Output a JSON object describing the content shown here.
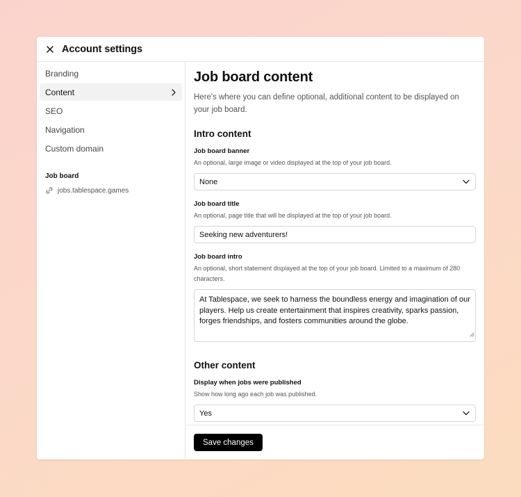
{
  "window": {
    "title": "Account settings"
  },
  "sidebar": {
    "items": [
      {
        "label": "Branding"
      },
      {
        "label": "Content"
      },
      {
        "label": "SEO"
      },
      {
        "label": "Navigation"
      },
      {
        "label": "Custom domain"
      }
    ],
    "active_index": 1,
    "job_board": {
      "heading": "Job board",
      "link": "jobs.tablespace.games"
    }
  },
  "main": {
    "title": "Job board content",
    "description": "Here's where you can define optional, additional content to be displayed on your job board.",
    "intro_section": {
      "title": "Intro content",
      "banner": {
        "label": "Job board banner",
        "help": "An optional, large image or video displayed at the top of your job board.",
        "value": "None"
      },
      "job_title": {
        "label": "Job board title",
        "help": "An optional, page title that will be displayed at the top of your job board.",
        "value": "Seeking new adventurers!"
      },
      "intro": {
        "label": "Job board intro",
        "help": "An optional, short statement displayed at the top of your job board. Limited to a maximum of 280 characters.",
        "value": "At Tablespace, we seek to harness the boundless energy and imagination of our players. Help us create entertainment that inspires creativity, sparks passion, forges friendships, and fosters communities around the globe."
      }
    },
    "other_section": {
      "title": "Other content",
      "published": {
        "label": "Display when jobs were published",
        "help": "Show how long ago each job was published.",
        "value": "Yes"
      }
    },
    "save_label": "Save changes"
  },
  "icons": {
    "close": "close-icon",
    "chevron_right": "chevron-right-icon",
    "chevron_down": "chevron-down-icon",
    "link": "link-icon"
  },
  "colors": {
    "primary_button": "#000000",
    "active_nav_bg": "#f2f2f2"
  }
}
